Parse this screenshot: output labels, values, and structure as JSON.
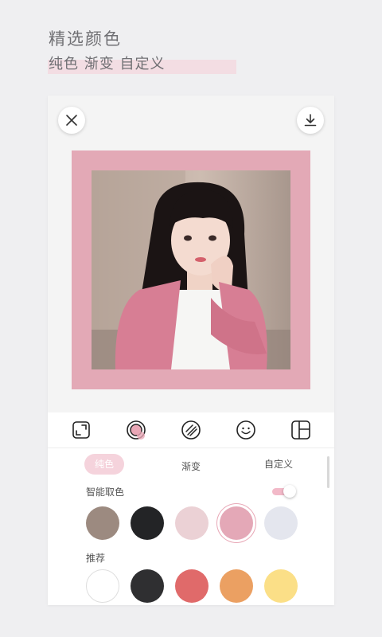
{
  "header": {
    "title": "精选颜色",
    "subtitle": "纯色 渐变 自定义"
  },
  "editor": {
    "close_icon": "close-icon",
    "download_icon": "download-icon",
    "frame_color": "#e3a9b6"
  },
  "toolbar": {
    "tools": [
      "crop-resize-icon",
      "border-color-icon",
      "pattern-icon",
      "sticker-smile-icon",
      "layout-icon"
    ],
    "selected": "border-color-icon"
  },
  "tabs": [
    {
      "label": "纯色",
      "active": true
    },
    {
      "label": "渐变",
      "active": false
    },
    {
      "label": "自定义",
      "active": false
    }
  ],
  "smart_pick": {
    "label": "智能取色",
    "enabled": true,
    "colors": [
      "#9c8a80",
      "#232426",
      "#ebd1d5",
      "#e4a8b7",
      "#e4e6ee"
    ],
    "selected_index": 3
  },
  "recommended": {
    "label": "推荐",
    "colors": [
      "#ffffff",
      "#2f2f31",
      "#e06a6a",
      "#eba062",
      "#fbdf87"
    ]
  }
}
